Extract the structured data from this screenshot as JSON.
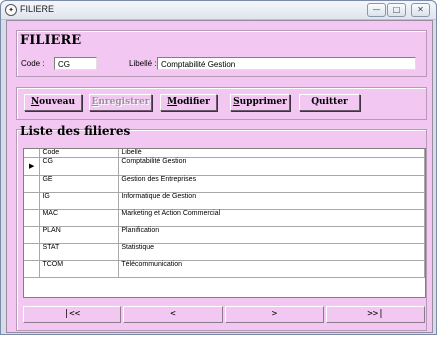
{
  "window": {
    "title": "FILIERE",
    "controls": {
      "minimize": "—",
      "maximize": "□",
      "close": "✕"
    }
  },
  "form": {
    "header": "FILIERE",
    "code_label": "Code :",
    "code_value": "CG",
    "libelle_label": "Libellé :",
    "libelle_value": "Comptabilité Gestion"
  },
  "toolbar": {
    "buttons": [
      {
        "accel": "N",
        "rest": "ouveau"
      },
      {
        "accel": "E",
        "rest": "nregistrer"
      },
      {
        "accel": "M",
        "rest": "odifier"
      },
      {
        "accel": "S",
        "rest": "upprimer"
      },
      {
        "accel": "",
        "rest": "Quitter"
      }
    ]
  },
  "list": {
    "header": "Liste des filieres",
    "columns": [
      "Code",
      "Libellé"
    ],
    "current_indicator": "▶",
    "rows": [
      {
        "code": "CG",
        "libelle": "Comptabilité Gestion"
      },
      {
        "code": "GE",
        "libelle": "Gestion des Entreprises"
      },
      {
        "code": "IG",
        "libelle": "Informatique de Gestion"
      },
      {
        "code": "MAC",
        "libelle": "Marketing et Action Commercial"
      },
      {
        "code": "PLAN",
        "libelle": "Planification"
      },
      {
        "code": "STAT",
        "libelle": "Statistique"
      },
      {
        "code": "TCOM",
        "libelle": "Télécommunication"
      }
    ]
  },
  "navigation": {
    "first": "|<<",
    "prev": "<",
    "next": ">",
    "last": ">>|"
  }
}
